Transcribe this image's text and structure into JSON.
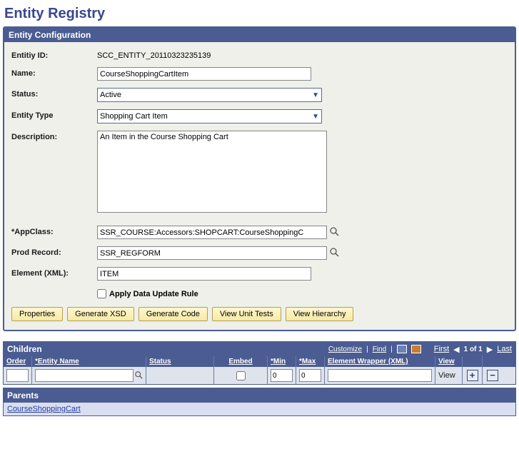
{
  "pageTitle": "Entity Registry",
  "entityConfig": {
    "header": "Entity Configuration",
    "labels": {
      "entityId": "Entitiy ID:",
      "name": "Name:",
      "status": "Status:",
      "entityType": "Entity Type",
      "description": "Description:",
      "appClass": "*AppClass:",
      "prodRecord": "Prod Record:",
      "elementXml": "Element (XML):",
      "applyRule": "Apply Data Update Rule"
    },
    "values": {
      "entityId": "SCC_ENTITY_20110323235139",
      "name": "CourseShoppingCartItem",
      "status": "Active",
      "entityType": "Shopping Cart Item",
      "description": "An Item in the Course Shopping Cart",
      "appClass": "SSR_COURSE:Accessors:SHOPCART:CourseShoppingC",
      "prodRecord": "SSR_REGFORM",
      "elementXml": "ITEM",
      "applyRuleChecked": false
    },
    "buttons": {
      "properties": "Properties",
      "genXsd": "Generate XSD",
      "genCode": "Generate Code",
      "viewTests": "View Unit Tests",
      "viewHierarchy": "View Hierarchy"
    }
  },
  "childrenGrid": {
    "title": "Children",
    "toolbar": {
      "customize": "Customize",
      "find": "Find",
      "first": "First",
      "pos": "1 of 1",
      "last": "Last"
    },
    "columns": {
      "order": "Order",
      "entityName": "*Entity Name",
      "status": "Status",
      "embed": "Embed",
      "min": "*Min",
      "max": "*Max",
      "wrapper": "Element Wrapper (XML)",
      "view": "View"
    },
    "row": {
      "order": "",
      "entityName": "",
      "status": "",
      "embedChecked": false,
      "min": "0",
      "max": "0",
      "wrapper": "",
      "viewLabel": "View"
    }
  },
  "parents": {
    "title": "Parents",
    "link": "CourseShoppingCart"
  }
}
